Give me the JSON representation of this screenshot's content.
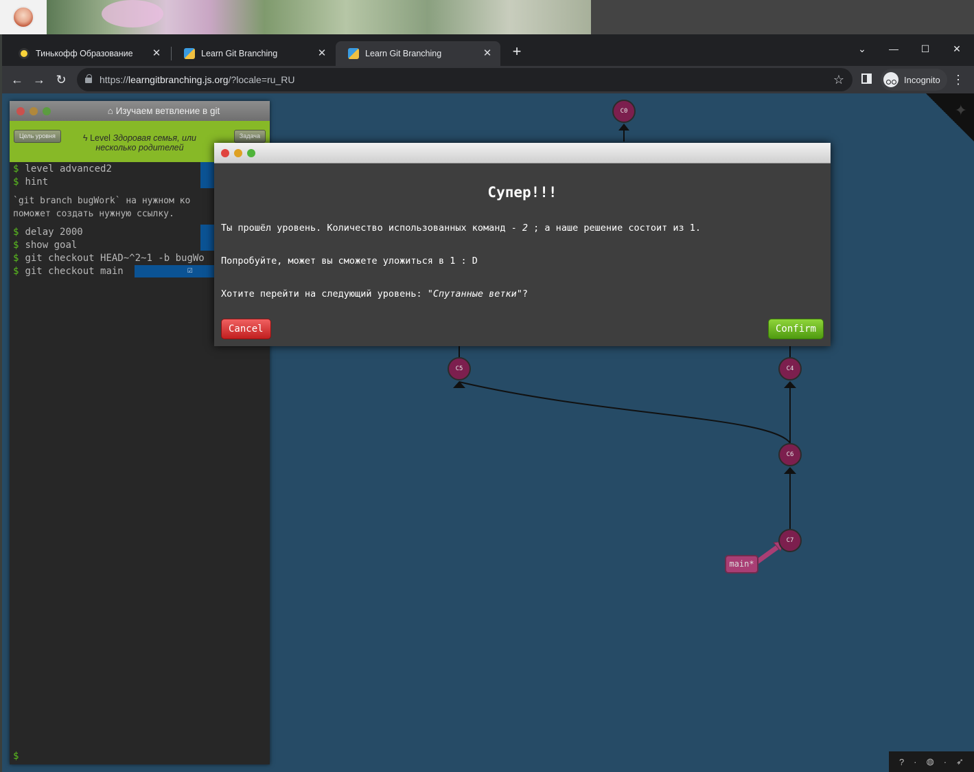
{
  "browser": {
    "tabs": [
      {
        "title": "Тинькофф Образование",
        "active": false
      },
      {
        "title": "Learn Git Branching",
        "active": false
      },
      {
        "title": "Learn Git Branching",
        "active": true
      }
    ],
    "url_scheme": "https://",
    "url_host": "learngitbranching.js.org",
    "url_path": "/?locale=ru_RU",
    "incognito_label": "Incognito"
  },
  "terminal": {
    "title": "Изучаем ветвление в git",
    "level_prefix": "Level",
    "level_name": "Здоровая семья, или несколько родителей",
    "goal_button": "Цель уровня",
    "task_button": "Задача",
    "commands_top": [
      "level advanced2",
      "hint"
    ],
    "hint_lines": [
      "`git branch bugWork` на нужном ко",
      "поможет создать нужную ссылку."
    ],
    "commands_bottom": [
      "delay 2000",
      "show goal",
      "git checkout HEAD~^2~1 -b bugWo",
      "git checkout main"
    ],
    "prompt": "$"
  },
  "modal": {
    "title": "Супер!!!",
    "line1_before": "Ты прошёл уровень. Количество использованных команд - ",
    "line1_count": "2",
    "line1_after": " ; а наше решение состоит из 1.",
    "line2": "Попробуйте, может вы сможете уложиться в 1 : D",
    "line3_before": "Хотите перейти на следующий уровень: ",
    "line3_level": "\"Спутанные ветки\"",
    "line3_after": "?",
    "cancel_label": "Cancel",
    "confirm_label": "Confirm"
  },
  "tree": {
    "commits": [
      "C0",
      "C5",
      "C4",
      "C6",
      "C7"
    ],
    "branch": "main*"
  },
  "colors": {
    "background": "#264b66",
    "commit_fill": "#7c1f4e",
    "branch_tag": "#a93e74",
    "terminal_bg": "#272727",
    "level_bar": "#87b927"
  }
}
